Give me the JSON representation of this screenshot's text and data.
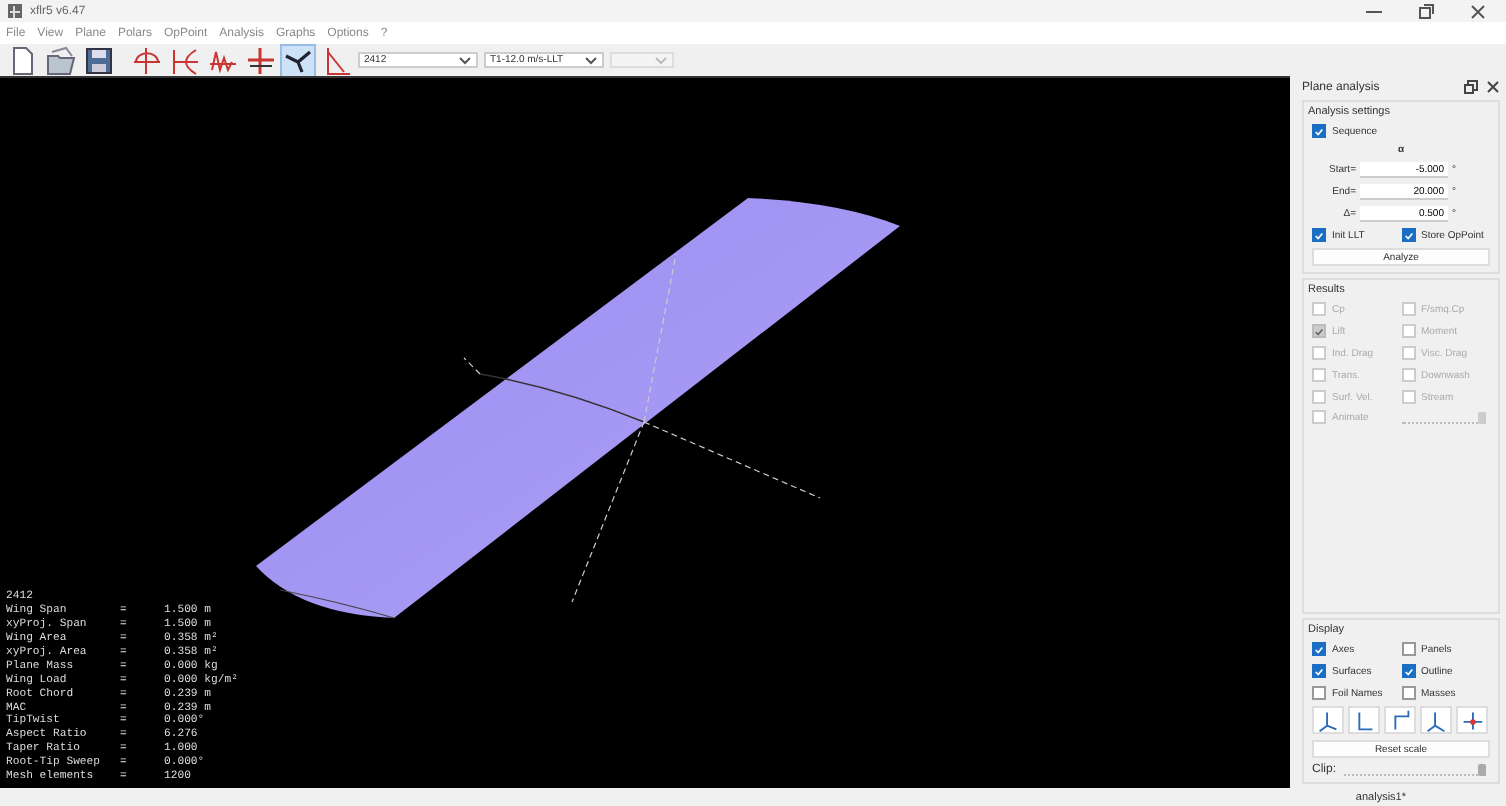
{
  "window": {
    "title": "xflr5 v6.47"
  },
  "menu": [
    "File",
    "View",
    "Plane",
    "Polars",
    "OpPoint",
    "Analysis",
    "Graphs",
    "Options",
    "?"
  ],
  "toolbar": {
    "buttons": [
      {
        "kind": "new",
        "selected": false
      },
      {
        "kind": "open",
        "selected": false
      },
      {
        "kind": "save",
        "selected": false
      },
      {
        "kind": "foil",
        "selected": false
      },
      {
        "kind": "polar",
        "selected": false
      },
      {
        "kind": "oppoint",
        "selected": false
      },
      {
        "kind": "cross",
        "selected": false
      },
      {
        "kind": "plane",
        "selected": true
      },
      {
        "kind": "stab",
        "selected": false
      }
    ],
    "combos": [
      {
        "value": "2412",
        "disabled": false
      },
      {
        "value": "T1-12.0 m/s-LLT",
        "disabled": false
      },
      {
        "disabled": true
      }
    ]
  },
  "viewport": {
    "info_title": "2412",
    "info": [
      {
        "label": "Wing Span",
        "value": "1.500 m"
      },
      {
        "label": "xyProj. Span",
        "value": "1.500 m"
      },
      {
        "label": "Wing Area",
        "value": "0.358 m²"
      },
      {
        "label": "xyProj. Area",
        "value": "0.358 m²"
      },
      {
        "label": "Plane Mass",
        "value": "0.000 kg"
      },
      {
        "label": "Wing Load",
        "value": "0.000 kg/m²"
      },
      {
        "label": "Root Chord",
        "value": "0.239 m"
      },
      {
        "label": "MAC",
        "value": "0.239 m"
      },
      {
        "label": "TipTwist",
        "value": "0.000°"
      },
      {
        "label": "Aspect Ratio",
        "value": "6.276"
      },
      {
        "label": "Taper Ratio",
        "value": "1.000"
      },
      {
        "label": "Root-Tip Sweep",
        "value": "0.000°"
      },
      {
        "label": "Mesh elements",
        "value": "1200"
      }
    ],
    "equals": "="
  },
  "panel": {
    "title": "Plane analysis",
    "settings": {
      "title": "Analysis settings",
      "sequence": {
        "label": "Sequence",
        "checked": true
      },
      "symbol": "α",
      "fields": [
        {
          "label": "Start=",
          "value": "-5.000",
          "unit": "°"
        },
        {
          "label": "End=",
          "value": "20.000",
          "unit": "°"
        },
        {
          "label": "Δ=",
          "value": "0.500",
          "unit": "°"
        }
      ],
      "options": [
        {
          "label": "Init LLT",
          "checked": true
        },
        {
          "label": "Store OpPoint",
          "checked": true
        }
      ],
      "button": "Analyze"
    },
    "results": {
      "title": "Results",
      "items": [
        {
          "label": "Cp",
          "checked": false,
          "disabled": true
        },
        {
          "label": "F/smq.Cp",
          "checked": false,
          "disabled": true
        },
        {
          "label": "Lift",
          "checked": true,
          "disabled": true
        },
        {
          "label": "Moment",
          "checked": false,
          "disabled": true
        },
        {
          "label": "Ind. Drag",
          "checked": false,
          "disabled": true
        },
        {
          "label": "Visc. Drag",
          "checked": false,
          "disabled": true
        },
        {
          "label": "Trans.",
          "checked": false,
          "disabled": true
        },
        {
          "label": "Downwash",
          "checked": false,
          "disabled": true
        },
        {
          "label": "Surf. Vel.",
          "checked": false,
          "disabled": true
        },
        {
          "label": "Stream",
          "checked": false,
          "disabled": true
        }
      ],
      "animate": {
        "label": "Animate",
        "checked": false,
        "disabled": true,
        "level": 1
      }
    },
    "display": {
      "title": "Display",
      "items": [
        {
          "label": "Axes",
          "checked": true
        },
        {
          "label": "Panels",
          "checked": false
        },
        {
          "label": "Surfaces",
          "checked": true
        },
        {
          "label": "Outline",
          "checked": true
        },
        {
          "label": "Foil Names",
          "checked": false
        },
        {
          "label": "Masses",
          "checked": false
        }
      ],
      "views": [
        {
          "kind": "iso"
        },
        {
          "kind": "front"
        },
        {
          "kind": "side"
        },
        {
          "kind": "top"
        },
        {
          "kind": "reset"
        }
      ],
      "reset_button": "Reset scale",
      "clip": {
        "label": "Clip:",
        "level": 1
      }
    }
  },
  "status_bar": {
    "text": "analysis1*"
  }
}
